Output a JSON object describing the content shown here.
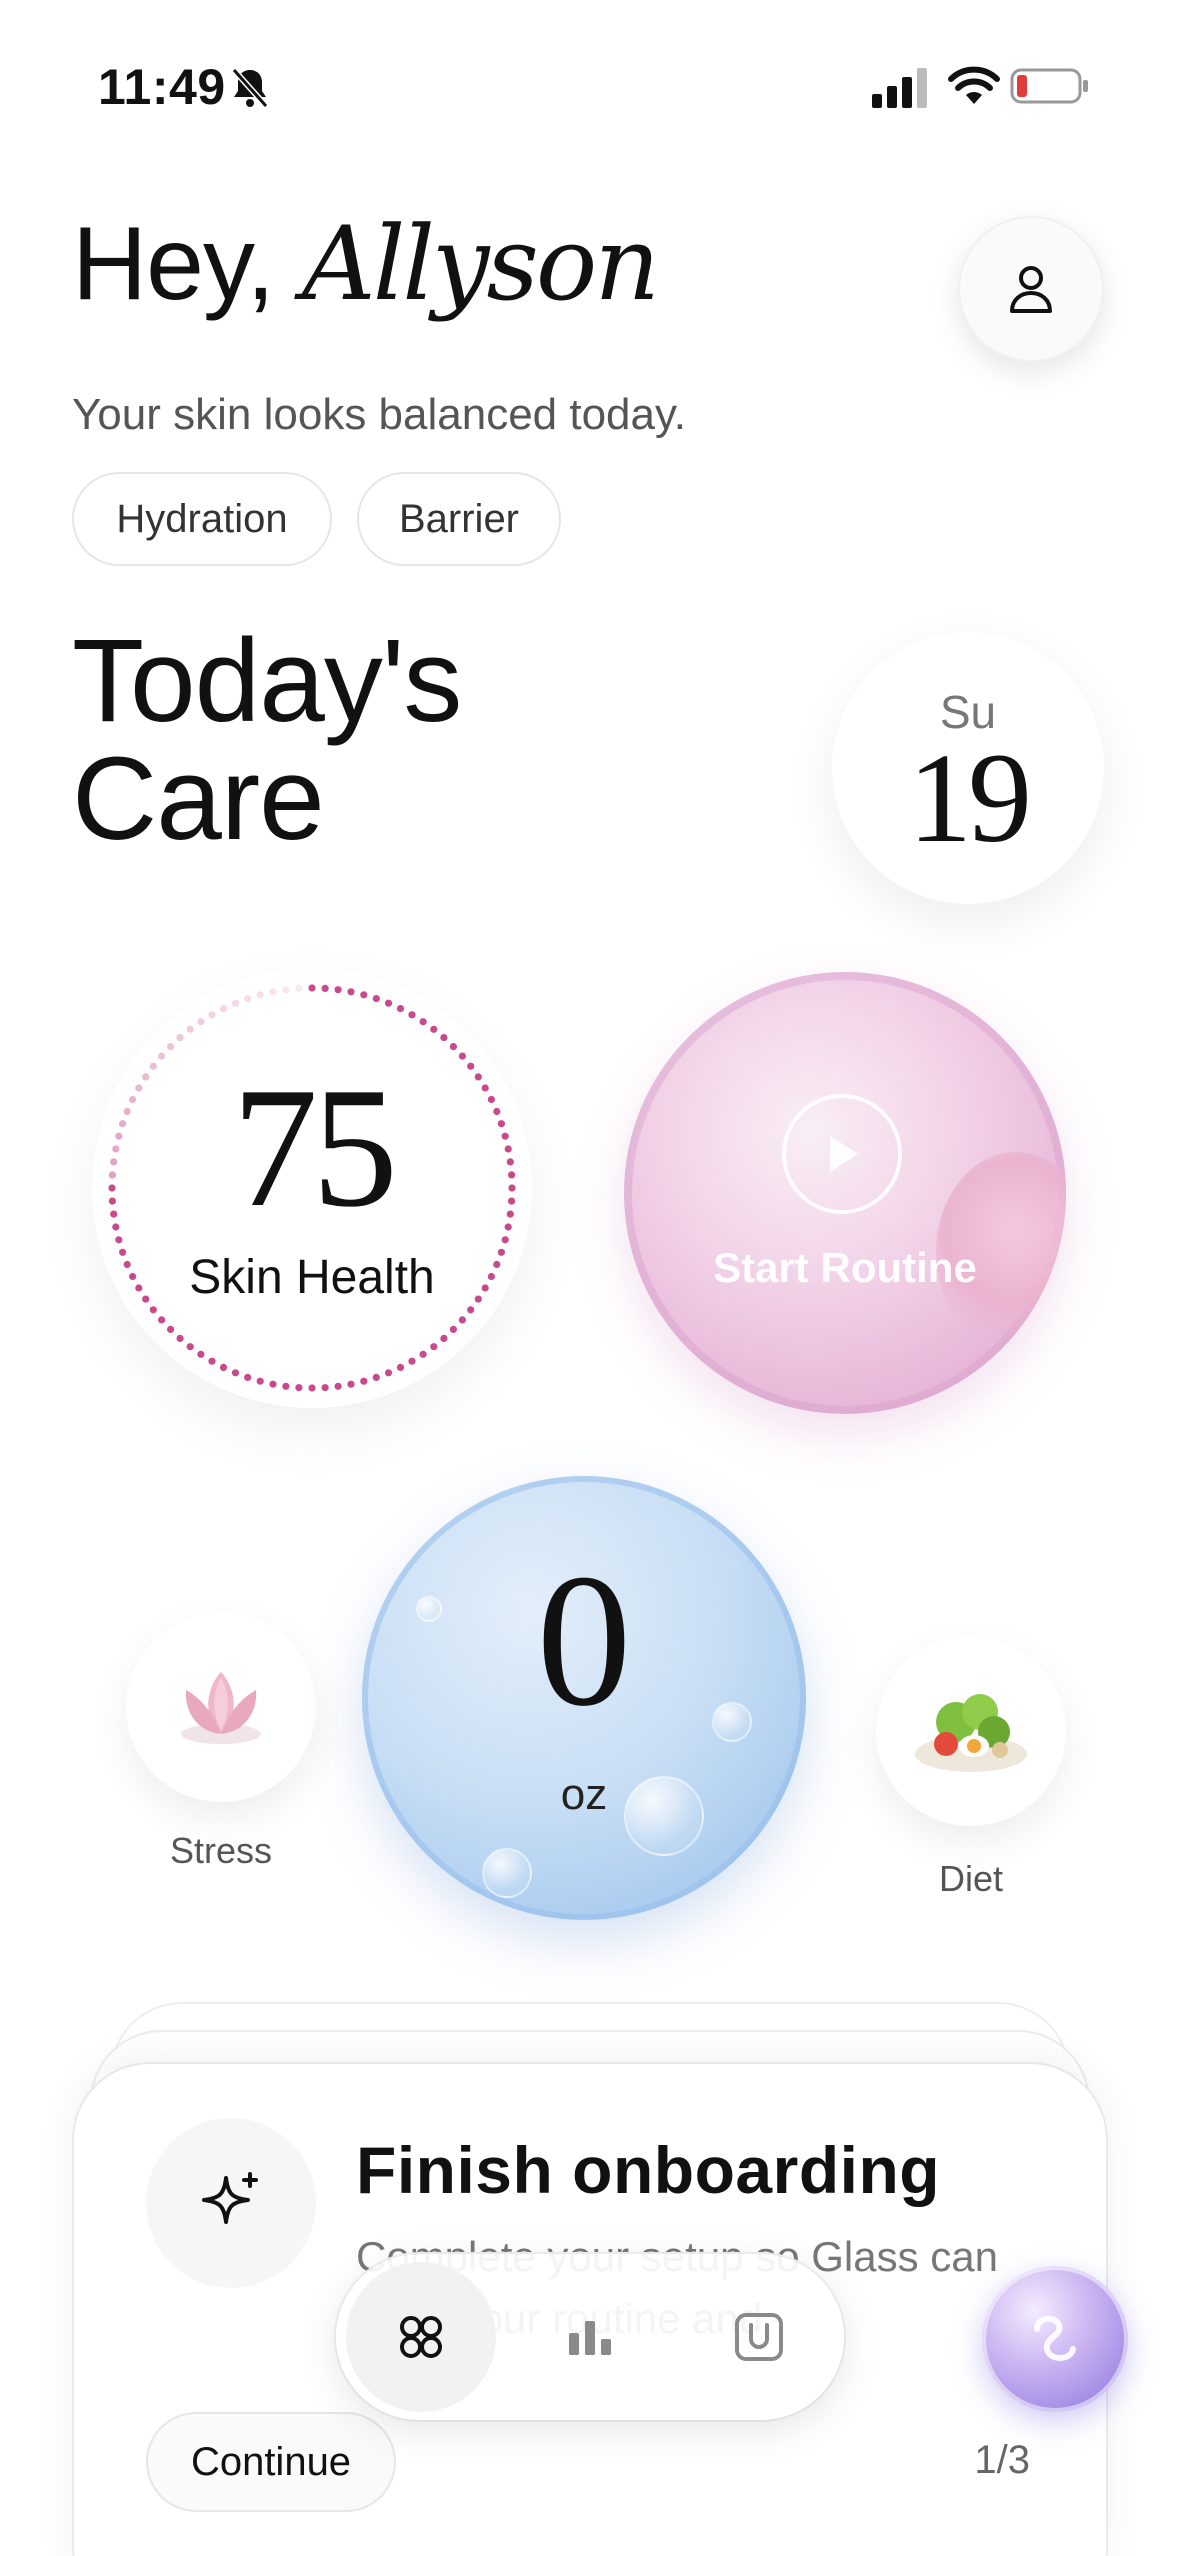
{
  "status_bar": {
    "time": "11:49",
    "icons": [
      "bell-slash-icon",
      "signal-icon",
      "wifi-icon",
      "battery-low-icon"
    ]
  },
  "header": {
    "greeting": "Hey,",
    "name": "Allyson",
    "subtitle": "Your skin looks balanced today.",
    "chips": [
      "Hydration",
      "Barrier"
    ],
    "profile_icon": "person-icon"
  },
  "today": {
    "title_line1": "Today's",
    "title_line2": "Care",
    "day": "Su",
    "date": "19"
  },
  "skin_health": {
    "value": "75",
    "label": "Skin Health",
    "progress": 0.75,
    "ring_color": "#c94a8c"
  },
  "routine": {
    "label": "Start Routine",
    "icon": "play-icon"
  },
  "water": {
    "value": "0",
    "unit": "oz"
  },
  "stress": {
    "label": "Stress",
    "icon": "lotus-icon"
  },
  "diet": {
    "label": "Diet",
    "icon": "salad-icon"
  },
  "onboarding": {
    "title": "Finish onboarding",
    "description": "Complete your setup so Glass can tailor your routine and",
    "continue_label": "Continue",
    "pager": "1/3",
    "icon": "sparkle-icon"
  },
  "tabbar": {
    "tabs": [
      "home-grid-icon",
      "stats-icon",
      "product-icon"
    ],
    "active": 0
  },
  "assistant": {
    "icon": "assistant-orb-icon"
  },
  "colors": {
    "accent_pink": "#c94a8c",
    "routine_pink": "#e7b6d6",
    "water_blue": "#a9cbef",
    "orb_purple": "#a58ee6"
  }
}
